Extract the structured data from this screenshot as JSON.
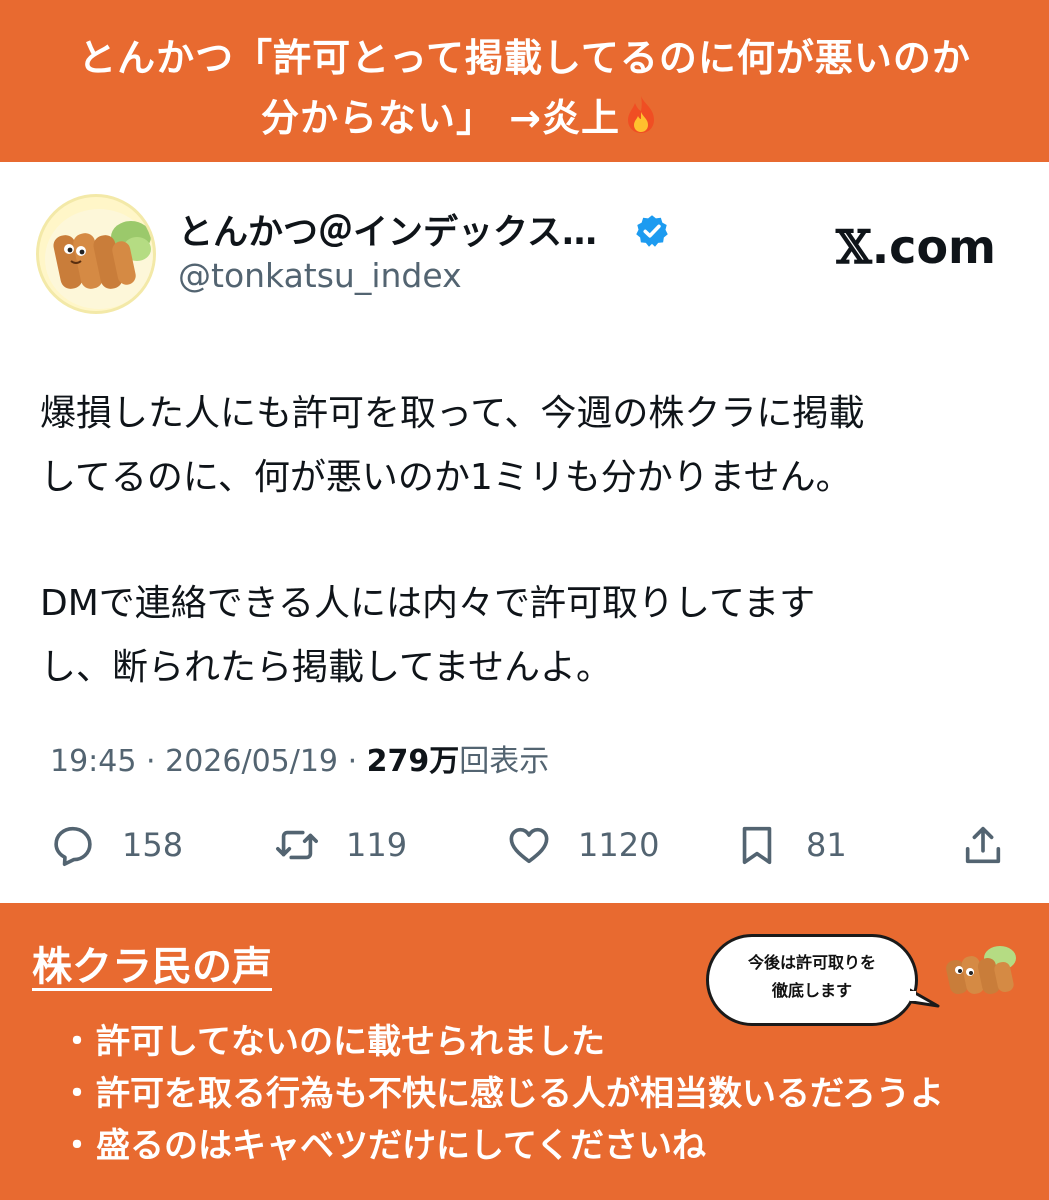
{
  "headline": {
    "line1": "とんかつ「許可とって掲載してるのに何が悪いのか",
    "line2": "分からない」 →炎上"
  },
  "tweet": {
    "display_name": "とんかつ＠インデックス…",
    "handle": "@tonkatsu_index",
    "source_logo_suffix": ".com",
    "paragraphs": [
      [
        "爆損した人にも許可を取って、今週の株クラに掲載",
        "してるのに、何が悪いのか1ミリも分かりません。"
      ],
      [
        "DMで連絡できる人には内々で許可取りしてます",
        "し、断られたら掲載してませんよ。"
      ]
    ],
    "time": "19:45",
    "date": "2026/05/19",
    "views_count": "279万",
    "views_label": "回表示",
    "actions": {
      "replies": "158",
      "reposts": "119",
      "likes": "1120",
      "bookmarks": "81"
    },
    "colors": {
      "verified": "#1d9bf0",
      "secondary_text": "#536471"
    }
  },
  "voices": {
    "title": "株クラ民の声",
    "bubble_line1": "今後は許可取りを",
    "bubble_line2": "徹底します",
    "items": [
      "許可してないのに載せられました",
      "許可を取る行為も不快に感じる人が相当数いるだろうよ",
      "盛るのはキャベツだけにしてくださいね"
    ]
  },
  "theme": {
    "accent": "#e86a30"
  }
}
